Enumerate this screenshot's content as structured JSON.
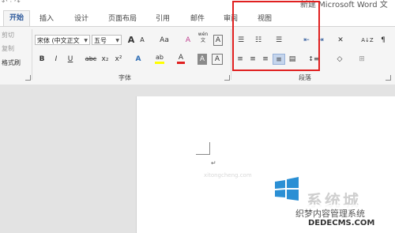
{
  "window": {
    "title_fragment": "新建 Microsoft Word 文",
    "qat_glyphs": "↶ · ↷"
  },
  "tabs": [
    {
      "label": "开始",
      "active": true
    },
    {
      "label": "插入"
    },
    {
      "label": "设计"
    },
    {
      "label": "页面布局"
    },
    {
      "label": "引用"
    },
    {
      "label": "邮件"
    },
    {
      "label": "审阅"
    },
    {
      "label": "视图"
    }
  ],
  "clipboard": {
    "items": [
      "剪切",
      "复制",
      "格式刷"
    ]
  },
  "font": {
    "name_value": "宋体 (中文正文",
    "size_value": "五号",
    "grow_glyph": "A",
    "shrink_glyph": "A",
    "case_glyph": "Aa",
    "clear_glyph": "A",
    "phonetic_glyph_top": "wén",
    "phonetic_glyph_bottom": "文",
    "border_glyph": "A",
    "bold": "B",
    "italic": "I",
    "underline": "U",
    "strike": "abc",
    "subscript": "x₂",
    "superscript": "x²",
    "effects_glyph": "A",
    "highlight_glyph": "ab",
    "color_glyph": "A",
    "shading_glyph": "A",
    "group_label": "字体"
  },
  "paragraph": {
    "group_label": "段落",
    "bullets_glyph": "☰",
    "numbering_glyph": "☷",
    "multilevel_glyph": "☰",
    "decrease_indent_glyph": "⇤",
    "increase_indent_glyph": "⇥",
    "align_left": "≡",
    "center": "≡",
    "align_right": "≡",
    "justify": "≡",
    "distributed": "▤",
    "line_spacing": "↕≡",
    "chinese_layout": "✕",
    "sort": "A↓Z",
    "show_marks": "¶",
    "shading_glyph": "◇",
    "borders_glyph": "⊞"
  },
  "document": {
    "paragraph_mark": "↵"
  },
  "watermark": {
    "url": "xitongcheng.com",
    "logo_text": "系统城",
    "badge_top": "织梦内容管理系统",
    "badge_bottom": "DEDECMS.COM"
  },
  "colors": {
    "accent": "#2b579a",
    "highlight_box": "#e02020",
    "selected_button": "#c5d5ec",
    "font_color_bar": "#e02020",
    "highlight_bar": "#ffff00",
    "effects_blue": "#2f6eb5"
  }
}
